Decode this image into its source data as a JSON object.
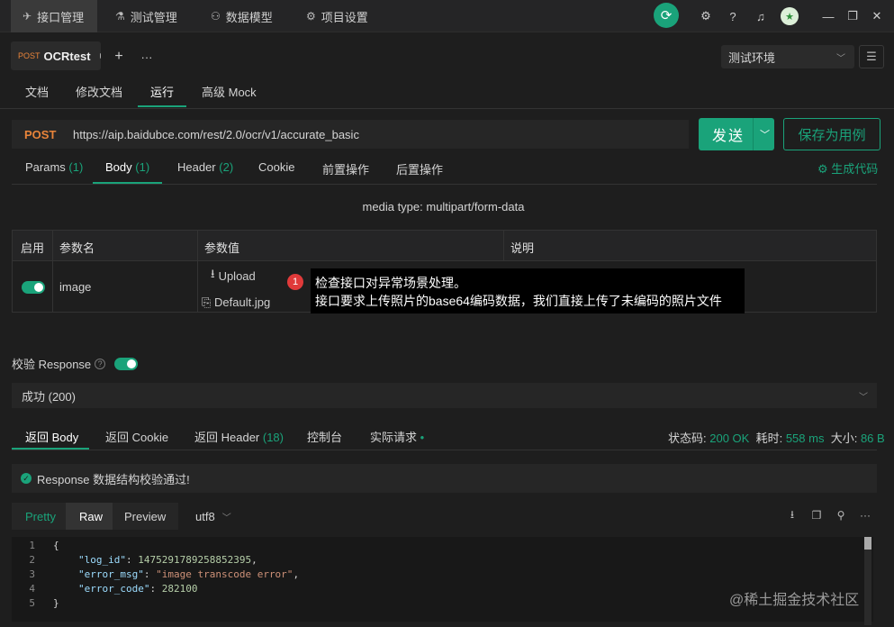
{
  "nav": {
    "tabs": [
      {
        "label": "接口管理",
        "icon": "send-icon"
      },
      {
        "label": "测试管理",
        "icon": "flask-icon"
      },
      {
        "label": "数据模型",
        "icon": "model-icon"
      },
      {
        "label": "项目设置",
        "icon": "gear-icon"
      }
    ]
  },
  "request_tab": {
    "method": "POST",
    "name": "OCRtest"
  },
  "env": {
    "selected": "测试环境"
  },
  "sub_tabs": [
    "文档",
    "修改文档",
    "运行",
    "高级 Mock"
  ],
  "request": {
    "method": "POST",
    "url": "https://aip.baidubce.com/rest/2.0/ocr/v1/accurate_basic",
    "send_label": "发送",
    "save_label": "保存为用例"
  },
  "param_tabs": [
    {
      "label": "Params",
      "count": "(1)"
    },
    {
      "label": "Body",
      "count": "(1)"
    },
    {
      "label": "Header",
      "count": "(2)"
    },
    {
      "label": "Cookie",
      "count": ""
    },
    {
      "label": "前置操作",
      "count": ""
    },
    {
      "label": "后置操作",
      "count": ""
    }
  ],
  "gen_code": "生成代码",
  "media_type": "media type: multipart/form-data",
  "table": {
    "headers": [
      "启用",
      "参数名",
      "参数值",
      "说明"
    ],
    "row": {
      "name": "image",
      "upload": "Upload",
      "file": "Default.jpg",
      "enabled": true
    }
  },
  "annotation": {
    "badge": "1",
    "line1": "检查接口对异常场景处理。",
    "line2": "接口要求上传照片的base64编码数据，我们直接上传了未编码的照片文件"
  },
  "validate": {
    "label": "校验 Response",
    "help": "?",
    "selected": "成功 (200)"
  },
  "resp_tabs": [
    {
      "label": "返回 Body",
      "count": ""
    },
    {
      "label": "返回 Cookie",
      "count": ""
    },
    {
      "label": "返回 Header",
      "count": "(18)"
    },
    {
      "label": "控制台",
      "count": ""
    },
    {
      "label": "实际请求",
      "count": ""
    }
  ],
  "status": {
    "code_label": "状态码:",
    "code": "200 OK",
    "time_label": "耗时:",
    "time": "558 ms",
    "size_label": "大小:",
    "size": "86 B"
  },
  "valid_msg": "Response 数据结构校验通过!",
  "format": {
    "pretty": "Pretty",
    "raw": "Raw",
    "preview": "Preview",
    "encoding": "utf8"
  },
  "code": {
    "line_numbers": [
      "1",
      "2",
      "3",
      "4",
      "5"
    ],
    "open_brace": "{",
    "close_brace": "}",
    "log_id_key": "\"log_id\"",
    "log_id_val": "1475291789258852395",
    "error_msg_key": "\"error_msg\"",
    "error_msg_val": "\"image transcode error\"",
    "error_code_key": "\"error_code\"",
    "error_code_val": "282100"
  },
  "watermark": "@稀土掘金技术社区",
  "colors": {
    "accent": "#1aa37a",
    "method": "#e8843a",
    "background": "#1e1e1e"
  }
}
